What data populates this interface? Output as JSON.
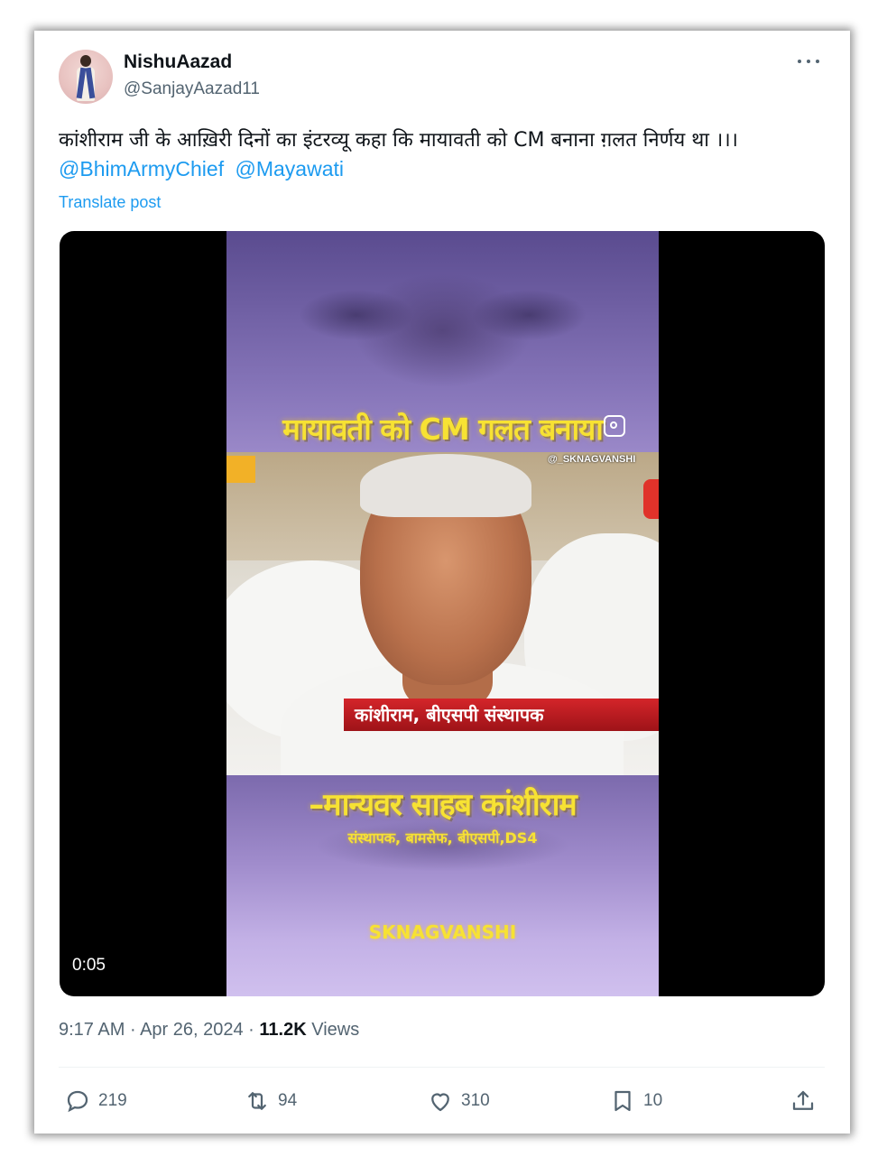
{
  "user": {
    "name": "NishuAazad",
    "handle": "@SanjayAazad11"
  },
  "post": {
    "text": "कांशीराम जी के आख़िरी दिनों का इंटरव्यू कहा कि मायावती को CM बनाना ग़लत निर्णय था ।।।",
    "mentions": [
      "@BhimArmyChief",
      "@Mayawati"
    ],
    "translate_label": "Translate post"
  },
  "video": {
    "caption_top": "मायावती को CM गलत बनाया",
    "watermark": "@_SKNAGVANSHI",
    "lower_third": "कांशीराम, बीएसपी संस्थापक",
    "caption_name": "–मान्यवर साहब कांशीराम",
    "caption_sub": "संस्थापक, बामसेफ, बीएसपी,DS4",
    "caption_sig": "SKNAGVANSHI",
    "duration": "0:05"
  },
  "meta": {
    "time": "9:17 AM",
    "separator": "·",
    "date": "Apr 26, 2024",
    "views_count": "11.2K",
    "views_label": "Views"
  },
  "actions": {
    "replies": "219",
    "reposts": "94",
    "likes": "310",
    "bookmarks": "10"
  },
  "icons": [
    "more-icon",
    "reply-icon",
    "repost-icon",
    "like-icon",
    "bookmark-icon",
    "share-icon",
    "instagram-icon"
  ],
  "colors": {
    "link": "#1d9bf0",
    "text": "#0f1419",
    "secondary": "#536471",
    "caption_yellow": "#f7e233",
    "lower_third_red": "#d4252a"
  }
}
